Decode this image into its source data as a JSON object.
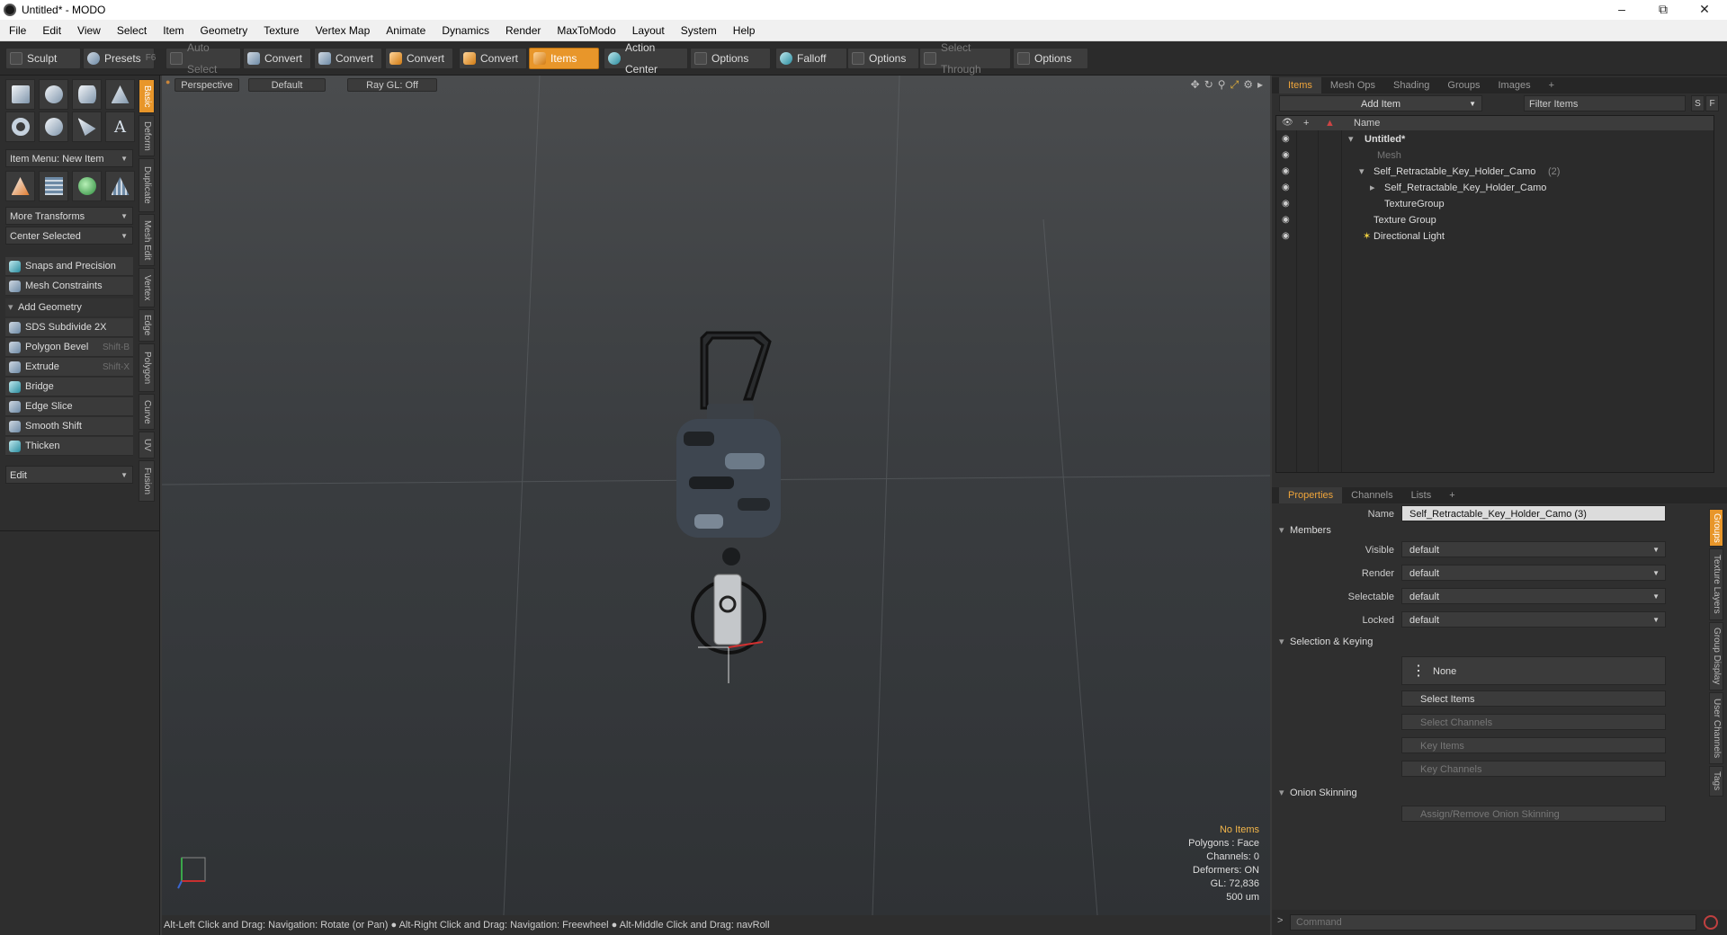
{
  "window": {
    "title": "Untitled* - MODO",
    "min": "–",
    "max": "⧉",
    "close": "✕"
  },
  "menu": [
    "File",
    "Edit",
    "View",
    "Select",
    "Item",
    "Geometry",
    "Texture",
    "Vertex Map",
    "Animate",
    "Dynamics",
    "Render",
    "MaxToModo",
    "Layout",
    "System",
    "Help"
  ],
  "toolbar": {
    "sculpt": "Sculpt",
    "presets": "Presets",
    "presets_key": "F6",
    "auto_select": "Auto Select",
    "convert1": "Convert",
    "convert2": "Convert",
    "convert3": "Convert",
    "convert4": "Convert",
    "items": "Items",
    "action_center": "Action Center",
    "options1": "Options",
    "falloff": "Falloff",
    "options2": "Options",
    "select_through": "Select Through",
    "options3": "Options"
  },
  "left": {
    "item_menu": "Item Menu: New Item",
    "more_transforms": "More Transforms",
    "center_selected": "Center Selected",
    "snaps": "Snaps and Precision",
    "constraints": "Mesh Constraints",
    "add_geometry": "Add Geometry",
    "tools": [
      {
        "label": "SDS Subdivide 2X",
        "shortcut": ""
      },
      {
        "label": "Polygon Bevel",
        "shortcut": "Shift-B"
      },
      {
        "label": "Extrude",
        "shortcut": "Shift-X"
      },
      {
        "label": "Bridge",
        "shortcut": ""
      },
      {
        "label": "Edge Slice",
        "shortcut": ""
      },
      {
        "label": "Smooth Shift",
        "shortcut": ""
      },
      {
        "label": "Thicken",
        "shortcut": ""
      }
    ],
    "edit": "Edit",
    "vtabs": [
      "Basic",
      "Deform",
      "Duplicate",
      "Mesh Edit",
      "Vertex",
      "Edge",
      "Polygon",
      "Curve",
      "UV",
      "Fusion"
    ]
  },
  "viewport": {
    "perspective": "Perspective",
    "default": "Default",
    "raygl": "Ray GL: Off",
    "stats": {
      "no_items": "No Items",
      "polygons": "Polygons : Face",
      "channels": "Channels: 0",
      "deformers": "Deformers: ON",
      "gl": "GL: 72,836",
      "scale": "500 um"
    }
  },
  "status": "Alt-Left Click and Drag: Navigation: Rotate (or Pan) ●  Alt-Right Click and Drag: Navigation: Freewheel ●  Alt-Middle Click and Drag: navRoll",
  "items_panel": {
    "tabs": [
      "Items",
      "Mesh Ops",
      "Shading",
      "Groups",
      "Images",
      "+"
    ],
    "add_item": "Add Item",
    "filter": "Filter Items",
    "s": "S",
    "f": "F",
    "col_name": "Name",
    "rows": [
      {
        "label": "Untitled*",
        "count": ""
      },
      {
        "label": "Mesh",
        "count": ""
      },
      {
        "label": "Self_Retractable_Key_Holder_Camo",
        "count": "(2)"
      },
      {
        "label": "Self_Retractable_Key_Holder_Camo",
        "count": ""
      },
      {
        "label": "TextureGroup",
        "count": ""
      },
      {
        "label": "Texture Group",
        "count": ""
      },
      {
        "label": "Directional Light",
        "count": ""
      }
    ]
  },
  "props_panel": {
    "tabs": [
      "Properties",
      "Channels",
      "Lists",
      "+"
    ],
    "name_label": "Name",
    "name_value": "Self_Retractable_Key_Holder_Camo (3)",
    "members": "Members",
    "visible_label": "Visible",
    "visible": "default",
    "render_label": "Render",
    "render": "default",
    "selectable_label": "Selectable",
    "selectable": "default",
    "locked_label": "Locked",
    "locked": "default",
    "sel_keying": "Selection & Keying",
    "none": "None",
    "select_items": "Select Items",
    "select_channels": "Select Channels",
    "key_items": "Key Items",
    "key_channels": "Key Channels",
    "onion": "Onion Skinning",
    "assign_onion": "Assign/Remove Onion Skinning",
    "rvtabs": [
      "Groups",
      "Texture Layers",
      "Group Display",
      "User Channels",
      "Tags"
    ]
  },
  "command": {
    "placeholder": "Command"
  }
}
